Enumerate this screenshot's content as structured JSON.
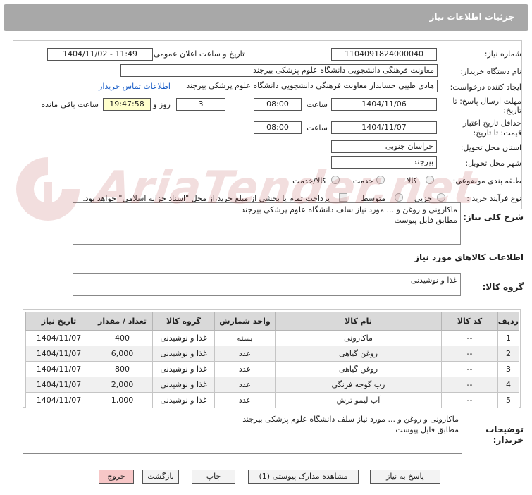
{
  "header": {
    "title": "جزئیات اطلاعات نیاز"
  },
  "form": {
    "need_number_label": "شماره نیاز:",
    "need_number": "1104091824000040",
    "announce_label": "تاریخ و ساعت اعلان عمومی:",
    "announce_value": "1404/11/02 - 11:49",
    "buyer_org_label": "نام دستگاه خریدار:",
    "buyer_org": "معاونت فرهنگی دانشجویی دانشگاه علوم پزشکی بیرجند",
    "creator_label": "ایجاد کننده درخواست:",
    "creator": "هادی طیبی حسابدار معاونت فرهنگی دانشجویی دانشگاه علوم پزشکی بیرجند",
    "contact_link": "اطلاعات تماس خریدار",
    "reply_deadline_label_1": "مهلت ارسال پاسخ: تا",
    "reply_deadline_label_2": "تاریخ:",
    "reply_date": "1404/11/06",
    "time_label": "ساعت",
    "reply_time": "08:00",
    "days_value": "3",
    "days_label": "روز و",
    "remaining_time": "19:47:58",
    "remaining_label": "ساعت باقی مانده",
    "price_validity_label_1": "حداقل تاریخ اعتبار",
    "price_validity_label_2": "قیمت: تا تاریخ:",
    "validity_date": "1404/11/07",
    "validity_time": "08:00",
    "province_label": "استان محل تحویل:",
    "province": "خراسان جنوبی",
    "city_label": "شهر محل تحویل:",
    "city": "بیرجند",
    "category_label": "طبقه بندی موضوعی:",
    "category_options": [
      "کالا",
      "خدمت",
      "کالا/خدمت"
    ],
    "process_label": "نوع فرآیند خرید :",
    "process_options": [
      "جزیی",
      "متوسط"
    ],
    "payment_note": "پرداخت تمام یا بخشی از مبلغ خرید،از محل \"اسناد خزانه اسلامی\" خواهد بود."
  },
  "description": {
    "label": "شرح کلی نیاز:",
    "lines": [
      "ماکارونی و روغن و ... مورد نیاز سلف دانشگاه علوم پزشکی بیرجند",
      "مطابق فایل پیوست"
    ]
  },
  "goods": {
    "section_title": "اطلاعات کالاهای مورد نیاز",
    "group_label": "گروه کالا:",
    "group_value": "غذا و نوشیدنی"
  },
  "table": {
    "headers": [
      "ردیف",
      "کد کالا",
      "نام کالا",
      "واحد شمارش",
      "گروه کالا",
      "تعداد / مقدار",
      "تاریخ نیاز"
    ],
    "rows": [
      [
        "1",
        "--",
        "ماکارونی",
        "بسته",
        "غذا و نوشیدنی",
        "400",
        "1404/11/07"
      ],
      [
        "2",
        "--",
        "روغن گیاهی",
        "عدد",
        "غذا و نوشیدنی",
        "6,000",
        "1404/11/07"
      ],
      [
        "3",
        "--",
        "روغن گیاهی",
        "عدد",
        "غذا و نوشیدنی",
        "800",
        "1404/11/07"
      ],
      [
        "4",
        "--",
        "رب گوجه فرنگی",
        "عدد",
        "غذا و نوشیدنی",
        "2,000",
        "1404/11/07"
      ],
      [
        "5",
        "--",
        "آب لیمو ترش",
        "عدد",
        "غذا و نوشیدنی",
        "1,000",
        "1404/11/07"
      ]
    ]
  },
  "notes": {
    "label_1": "توضیحات",
    "label_2": "خریدار:",
    "lines": [
      "ماکارونی و روغن و ... مورد نیاز سلف دانشگاه علوم پزشکی بیرجند",
      "مطابق فایل پیوست"
    ]
  },
  "buttons": {
    "reply": "پاسخ به نیاز",
    "docs": "مشاهده مدارک پیوستی (1)",
    "print": "چاپ",
    "back": "بازگشت",
    "exit": "خروج"
  },
  "watermark": {
    "text": "AriaTender.net"
  },
  "colors": {
    "header_bg": "#a8a8a8",
    "link": "#1a5ec7",
    "highlight": "#ffffcc",
    "exit_btn": "#f7c7c7"
  }
}
